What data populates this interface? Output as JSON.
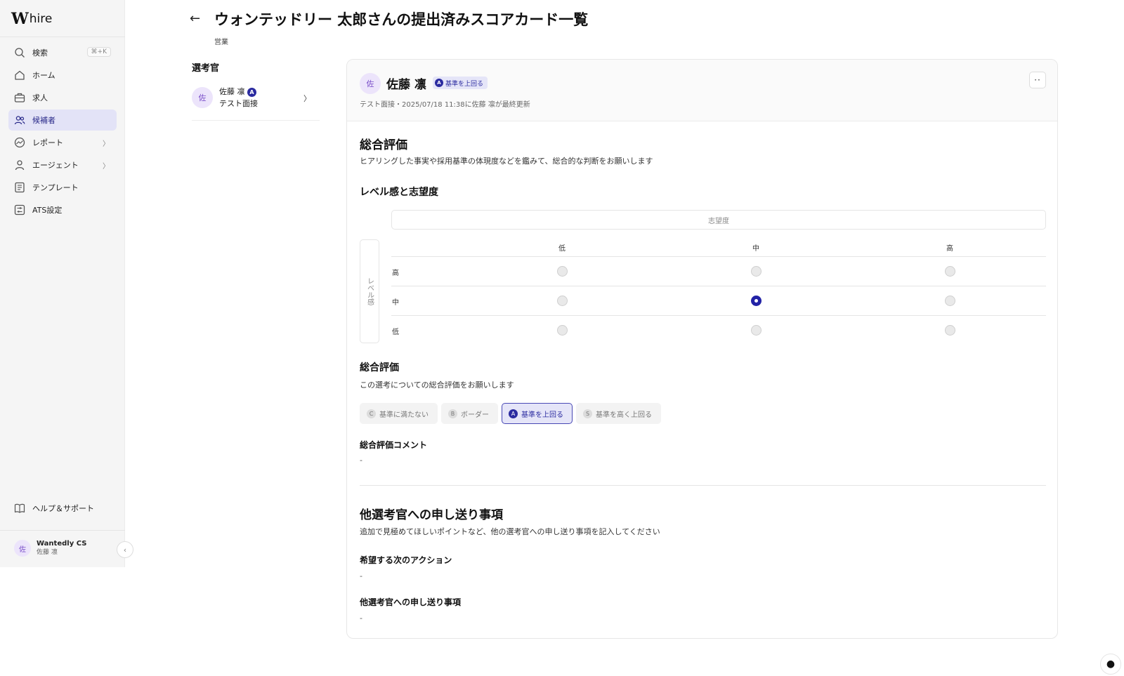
{
  "brand": {
    "logo_mark": "W",
    "app_name": "hire"
  },
  "sidebar": {
    "items": [
      {
        "label": "検索",
        "icon": "search-icon",
        "shortcut": "⌘+K"
      },
      {
        "label": "ホーム",
        "icon": "home-icon"
      },
      {
        "label": "求人",
        "icon": "briefcase-icon"
      },
      {
        "label": "候補者",
        "icon": "users-icon",
        "active": true
      },
      {
        "label": "レポート",
        "icon": "chart-icon",
        "has_children": true
      },
      {
        "label": "エージェント",
        "icon": "agent-icon",
        "has_children": true
      },
      {
        "label": "テンプレート",
        "icon": "template-icon"
      },
      {
        "label": "ATS設定",
        "icon": "settings-icon"
      }
    ],
    "help_label": "ヘルプ＆サポート",
    "user": {
      "avatar": "佐",
      "org": "Wantedly CS",
      "name": "佐藤 凛"
    }
  },
  "header": {
    "title": "ウォンテッドリー 太郎さんの提出済みスコアカード一覧",
    "subtitle": "営業"
  },
  "evaluators": {
    "label": "選考官",
    "items": [
      {
        "avatar": "佐",
        "name": "佐藤 凛",
        "grade": "A",
        "interview": "テスト面接"
      }
    ]
  },
  "scorecard": {
    "avatar": "佐",
    "name": "佐藤 凛",
    "badge_grade": "A",
    "badge_label": "基準を上回る",
    "meta": "テスト面接・2025/07/18 11:38に佐藤 凛が最終更新",
    "overall_title": "総合評価",
    "overall_desc": "ヒアリングした事実や採用基準の体現度などを鑑みて、総合的な判断をお願いします",
    "matrix": {
      "title": "レベル感と志望度",
      "x_axis_label": "志望度",
      "y_axis_label": "レベル感",
      "columns": [
        "低",
        "中",
        "高"
      ],
      "rows": [
        "高",
        "中",
        "低"
      ],
      "selected": {
        "row": "中",
        "column": "中"
      }
    },
    "grade_section": {
      "title": "総合評価",
      "desc": "この選考についての総合評価をお願いします",
      "options": [
        {
          "letter": "C",
          "label": "基準に満たない"
        },
        {
          "letter": "B",
          "label": "ボーダー"
        },
        {
          "letter": "A",
          "label": "基準を上回る",
          "selected": true
        },
        {
          "letter": "S",
          "label": "基準を高く上回る"
        }
      ],
      "comment_label": "総合評価コメント",
      "comment_value": "-"
    },
    "handover": {
      "title": "他選考官への申し送り事項",
      "desc": "追加で見極めてほしいポイントなど、他の選考官への申し送り事項を記入してください",
      "next_action_label": "希望する次のアクション",
      "next_action_value": "-",
      "notes_label": "他選考官への申し送り事項",
      "notes_value": "-"
    }
  },
  "colors": {
    "accent": "#2b2ba0",
    "active_nav_bg": "#e3e3f7",
    "sidebar_bg": "#f5f5f5"
  }
}
